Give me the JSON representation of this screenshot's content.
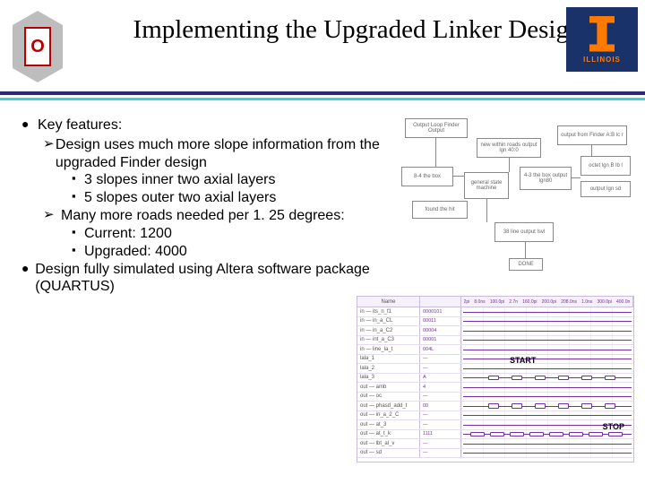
{
  "title": "Implementing the Upgraded Linker Design",
  "logos": {
    "left_letter": "O",
    "right_label": "ILLINOIS"
  },
  "bullets": {
    "key_features": "Key features:",
    "design_uses": "Design uses much more slope information from the upgraded Finder design",
    "slopes_inner": "3 slopes inner two axial layers",
    "slopes_outer": "5 slopes outer two axial layers",
    "many_roads": "Many more roads needed per 1. 25 degrees:",
    "current": "Current: 1200",
    "upgraded": "Upgraded: 4000",
    "simulated": "Design fully simulated using Altera software package (QUARTUS)"
  },
  "diagram": {
    "b1": "Output Loop Finder\nOutput",
    "b2": "new within roads\noutput lgn 40:0",
    "b3": "output from Finder\nA:B lc r",
    "b4": "8-4 the box",
    "b5": "general\nstate\nmachine",
    "b6": "found the hit",
    "b7": "4-3 the box\noutput lgn80",
    "b8": "octet lgn B\nlb l",
    "b9": "output lgn sd",
    "b10": "38 line\noutput lsvl",
    "b11": "DONE"
  },
  "waveform": {
    "hdr_name": "Name",
    "ticks": [
      "2pi",
      "8.0ns",
      "100.0pi",
      "2.7n",
      "160.0pi",
      "200.0pi",
      "208.0ns",
      "1.0ns",
      "300.0pi",
      "400.0n"
    ],
    "start_label": "START",
    "stop_label": "STOP",
    "rows": [
      {
        "n": "in — its_n_f1",
        "v": "0000101"
      },
      {
        "n": "in — in_a_CL",
        "v": "00011"
      },
      {
        "n": "in — in_a_C2",
        "v": "00004"
      },
      {
        "n": "in — int_a_C3",
        "v": "00001"
      },
      {
        "n": "in — line_la_t",
        "v": "004L"
      },
      {
        "n": "lala_1",
        "v": "—"
      },
      {
        "n": "lala_2",
        "v": "—"
      },
      {
        "n": "lala_3",
        "v": "A"
      },
      {
        "n": "out — amb",
        "v": "4"
      },
      {
        "n": "out — oc",
        "v": "—"
      },
      {
        "n": "out — phasd_add_t",
        "v": "00"
      },
      {
        "n": "out — in_a_2_C",
        "v": "—"
      },
      {
        "n": "out — at_3",
        "v": "—"
      },
      {
        "n": "out — at_t_k",
        "v": "1111"
      },
      {
        "n": "out — lbt_al_v",
        "v": "—"
      },
      {
        "n": "out — sd",
        "v": "—"
      }
    ]
  }
}
